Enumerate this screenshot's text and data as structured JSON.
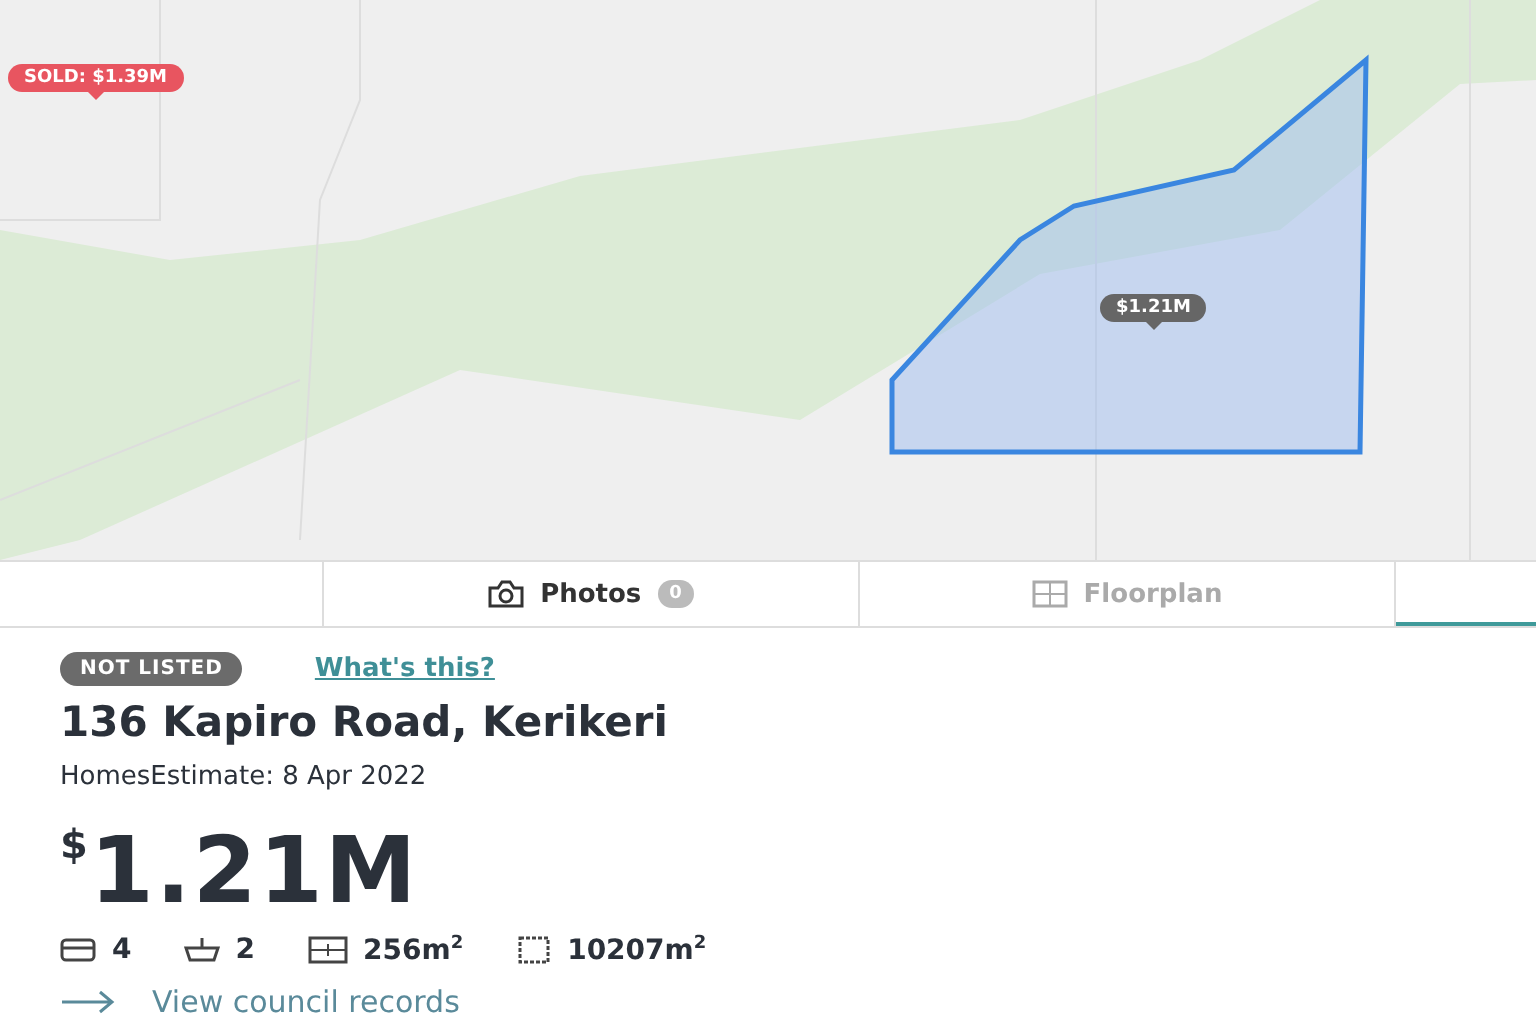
{
  "map": {
    "pins": [
      {
        "label": "SOLD: $1.39M",
        "kind": "sold"
      },
      {
        "label": "$1.21M",
        "kind": "estimate"
      }
    ]
  },
  "tabs": [
    {
      "kind": "blank",
      "selected": false
    },
    {
      "kind": "photos",
      "label": "Photos",
      "count": "0",
      "selected": false,
      "disabled": false
    },
    {
      "kind": "floorplan",
      "label": "Floorplan",
      "selected": false,
      "disabled": true
    },
    {
      "kind": "blank",
      "selected": true
    }
  ],
  "listing": {
    "status": "NOT LISTED",
    "help_link": "What's this?",
    "address": "136 Kapiro Road, Kerikeri",
    "estimate_date": "HomesEstimate: 8 Apr 2022",
    "price": "$^{$}$1.21M",
    "features": [
      {
        "kind": "bed",
        "value": "4"
      },
      {
        "kind": "bath",
        "value": "2"
      },
      {
        "kind": "floor",
        "value": "256m$^{2}$"
      },
      {
        "kind": "land",
        "value": "10207m$^{2}$"
      }
    ],
    "records_link": "View council records"
  }
}
